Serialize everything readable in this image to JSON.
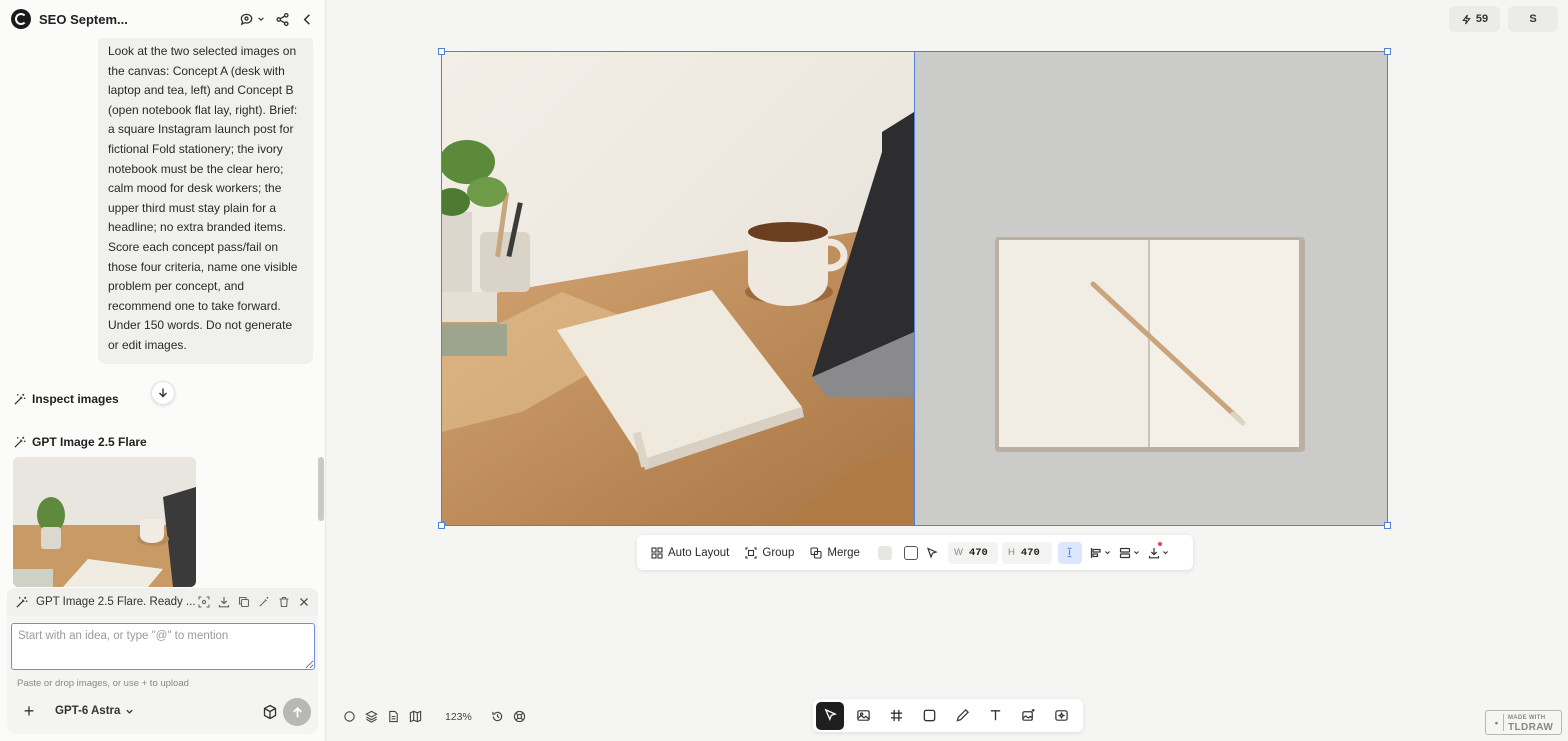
{
  "header": {
    "title": "SEO Septem..."
  },
  "chat": {
    "user_message": "Look at the two selected images on the canvas: Concept A (desk with laptop and tea, left) and Concept B (open notebook flat lay, right). Brief: a square Instagram launch post for fictional Fold stationery; the ivory notebook must be the clear hero; calm mood for desk workers; the upper third must stay plain for a headline; no extra branded items. Score each concept pass/fail on those four criteria, name one visible problem per concept, and recommend one to take forward. Under 150 words. Do not generate or edit images.",
    "step_inspect": "Inspect images",
    "step_generate": "GPT Image 2.5 Flare"
  },
  "status_bar": {
    "text": "GPT Image 2.5 Flare. Ready ..."
  },
  "composer": {
    "placeholder": "Start with an idea, or type \"@\" to mention",
    "upload_hint": "Paste or drop images, or use + to upload",
    "plus_label": "+",
    "model": "GPT-6 Astra"
  },
  "top_right": {
    "credits": "59",
    "user_initial": "S"
  },
  "selection_toolbar": {
    "auto_layout": "Auto Layout",
    "group": "Group",
    "merge": "Merge",
    "width_label": "W",
    "width_value": "470",
    "height_label": "H",
    "height_value": "470"
  },
  "bottom": {
    "zoom": "123%"
  },
  "branding": {
    "line1": "MADE WITH",
    "line2": "TLDRAW"
  },
  "colors": {
    "selection": "#4f81d9",
    "active_tool": "#1f1f1f",
    "send_button": "#b8b8b6"
  }
}
